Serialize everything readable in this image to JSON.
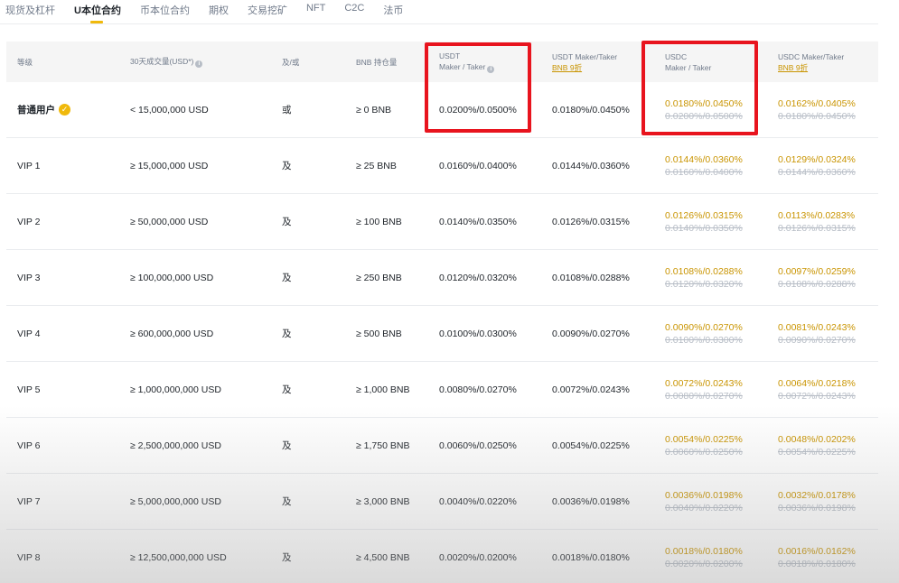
{
  "tabs": [
    {
      "label": "现货及杠杆",
      "active": false
    },
    {
      "label": "U本位合约",
      "active": true
    },
    {
      "label": "币本位合约",
      "active": false
    },
    {
      "label": "期权",
      "active": false
    },
    {
      "label": "交易挖矿",
      "active": false
    },
    {
      "label": "NFT",
      "active": false
    },
    {
      "label": "C2C",
      "active": false
    },
    {
      "label": "法币",
      "active": false
    }
  ],
  "headers": {
    "level": "等级",
    "volume": "30天成交量(USD*)",
    "and_or": "及/或",
    "bnb": "BNB 持仓量",
    "usdt_line1": "USDT",
    "usdt_line2": "Maker / Taker",
    "usdt9_line1": "USDT Maker/Taker",
    "usdt9_line2": "BNB 9折",
    "usdc_line1": "USDC",
    "usdc_line2": "Maker / Taker",
    "usdc9_line1": "USDC Maker/Taker",
    "usdc9_line2": "BNB 9折"
  },
  "rows": [
    {
      "level": "普通用户",
      "volume": "< 15,000,000 USD",
      "and_or": "或",
      "bnb": "≥ 0 BNB",
      "usdt": "0.0200%/0.0500%",
      "usdt9": "0.0180%/0.0450%",
      "usdc": "0.0180%/0.0450%",
      "usdc_orig": "0.0200%/0.0500%",
      "usdc9": "0.0162%/0.0405%",
      "usdc9_orig": "0.0180%/0.0450%"
    },
    {
      "level": "VIP 1",
      "volume": "≥ 15,000,000 USD",
      "and_or": "及",
      "bnb": "≥ 25 BNB",
      "usdt": "0.0160%/0.0400%",
      "usdt9": "0.0144%/0.0360%",
      "usdc": "0.0144%/0.0360%",
      "usdc_orig": "0.0160%/0.0400%",
      "usdc9": "0.0129%/0.0324%",
      "usdc9_orig": "0.0144%/0.0360%"
    },
    {
      "level": "VIP 2",
      "volume": "≥ 50,000,000 USD",
      "and_or": "及",
      "bnb": "≥ 100 BNB",
      "usdt": "0.0140%/0.0350%",
      "usdt9": "0.0126%/0.0315%",
      "usdc": "0.0126%/0.0315%",
      "usdc_orig": "0.0140%/0.0350%",
      "usdc9": "0.0113%/0.0283%",
      "usdc9_orig": "0.0126%/0.0315%"
    },
    {
      "level": "VIP 3",
      "volume": "≥ 100,000,000 USD",
      "and_or": "及",
      "bnb": "≥ 250 BNB",
      "usdt": "0.0120%/0.0320%",
      "usdt9": "0.0108%/0.0288%",
      "usdc": "0.0108%/0.0288%",
      "usdc_orig": "0.0120%/0.0320%",
      "usdc9": "0.0097%/0.0259%",
      "usdc9_orig": "0.0108%/0.0288%"
    },
    {
      "level": "VIP 4",
      "volume": "≥ 600,000,000 USD",
      "and_or": "及",
      "bnb": "≥ 500 BNB",
      "usdt": "0.0100%/0.0300%",
      "usdt9": "0.0090%/0.0270%",
      "usdc": "0.0090%/0.0270%",
      "usdc_orig": "0.0100%/0.0300%",
      "usdc9": "0.0081%/0.0243%",
      "usdc9_orig": "0.0090%/0.0270%"
    },
    {
      "level": "VIP 5",
      "volume": "≥ 1,000,000,000 USD",
      "and_or": "及",
      "bnb": "≥ 1,000 BNB",
      "usdt": "0.0080%/0.0270%",
      "usdt9": "0.0072%/0.0243%",
      "usdc": "0.0072%/0.0243%",
      "usdc_orig": "0.0080%/0.0270%",
      "usdc9": "0.0064%/0.0218%",
      "usdc9_orig": "0.0072%/0.0243%"
    },
    {
      "level": "VIP 6",
      "volume": "≥ 2,500,000,000 USD",
      "and_or": "及",
      "bnb": "≥ 1,750 BNB",
      "usdt": "0.0060%/0.0250%",
      "usdt9": "0.0054%/0.0225%",
      "usdc": "0.0054%/0.0225%",
      "usdc_orig": "0.0060%/0.0250%",
      "usdc9": "0.0048%/0.0202%",
      "usdc9_orig": "0.0054%/0.0225%"
    },
    {
      "level": "VIP 7",
      "volume": "≥ 5,000,000,000 USD",
      "and_or": "及",
      "bnb": "≥ 3,000 BNB",
      "usdt": "0.0040%/0.0220%",
      "usdt9": "0.0036%/0.0198%",
      "usdc": "0.0036%/0.0198%",
      "usdc_orig": "0.0040%/0.0220%",
      "usdc9": "0.0032%/0.0178%",
      "usdc9_orig": "0.0036%/0.0198%"
    },
    {
      "level": "VIP 8",
      "volume": "≥ 12,500,000,000 USD",
      "and_or": "及",
      "bnb": "≥ 4,500 BNB",
      "usdt": "0.0020%/0.0200%",
      "usdt9": "0.0018%/0.0180%",
      "usdc": "0.0018%/0.0180%",
      "usdc_orig": "0.0020%/0.0200%",
      "usdc9": "0.0016%/0.0162%",
      "usdc9_orig": "0.0018%/0.0180%"
    }
  ],
  "colors": {
    "accent": "#f0b90b",
    "discount_text": "#c99400",
    "highlight_box": "#e8141e"
  }
}
